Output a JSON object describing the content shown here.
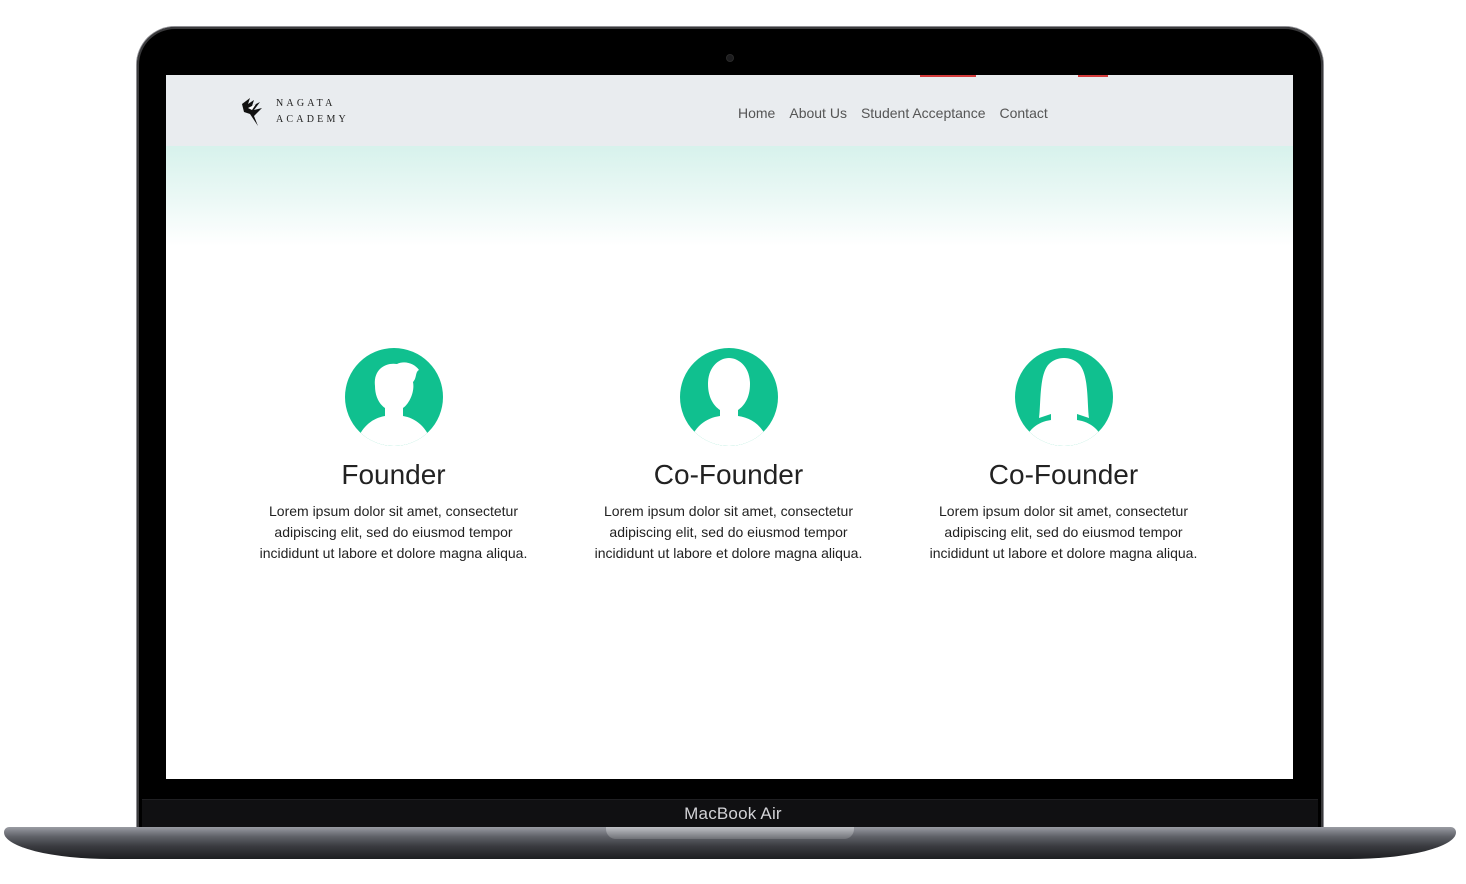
{
  "device": {
    "label": "MacBook Air"
  },
  "navbar": {
    "logo": {
      "line1": "NAGATA",
      "line2": "ACADEMY"
    },
    "links": [
      "Home",
      "About Us",
      "Student Acceptance",
      "Contact"
    ]
  },
  "team": [
    {
      "role": "Founder",
      "text": "Lorem ipsum dolor sit amet, consectetur adipiscing elit, sed do eiusmod tempor incididunt ut labore et dolore magna aliqua.",
      "avatar": "male-avatar-icon"
    },
    {
      "role": "Co-Founder",
      "text": "Lorem ipsum dolor sit amet, consectetur adipiscing elit, sed do eiusmod tempor incididunt ut labore et dolore magna aliqua.",
      "avatar": "person-avatar-icon"
    },
    {
      "role": "Co-Founder",
      "text": "Lorem ipsum dolor sit amet, consectetur adipiscing elit, sed do eiusmod tempor incididunt ut labore et dolore magna aliqua.",
      "avatar": "female-avatar-icon"
    }
  ],
  "colors": {
    "accent": "#10c08f",
    "navbar_bg": "#e9ecef",
    "hero_tint": "#d7f2ec"
  }
}
